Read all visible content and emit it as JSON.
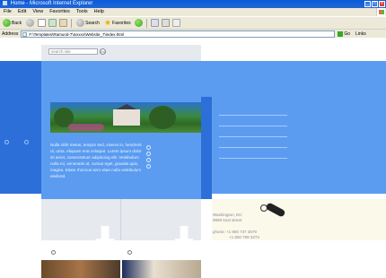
{
  "window": {
    "title": "Home - Microsoft Internet Explorer",
    "controls": {
      "minimize": "_",
      "maximize": "□",
      "close": "×"
    }
  },
  "menu": [
    "File",
    "Edit",
    "View",
    "Favorites",
    "Tools",
    "Help"
  ],
  "toolbar": {
    "back_label": "Back",
    "search_label": "Search",
    "favorites_label": "Favorites"
  },
  "address": {
    "label": "Address",
    "value": "F:\\Templates\\Ramund-7\\Ixxxxx\\Website_7\\index.html",
    "go_label": "Go",
    "links_label": "Links"
  },
  "site": {
    "search_placeholder": "search site",
    "search_go": "Go",
    "body_text": "Nulla nibh metus, tempor sed, viverra in, hendrerit ut, urna. Aliquam erat volutpat. Lorem ipsum dolor sit amet, consectetuer adipiscing elit. Vestibulum nulla mi, venenatis at, cursus eget, gravida quis, magna. Etiam rhoncus sem vitae nulla vestibulum eleifend.",
    "contact_line1": "Washington, DC",
    "contact_line2": "9999 51st street",
    "phone_label": "phone:",
    "phone1": "+1 800 737 3579",
    "phone2": "+1 800 799 3273"
  },
  "colors": {
    "accent_blue": "#5b9cf0",
    "dark_blue": "#2c6fd9",
    "panel_gray": "#e6e9ee",
    "cream": "#fbf9ea"
  }
}
